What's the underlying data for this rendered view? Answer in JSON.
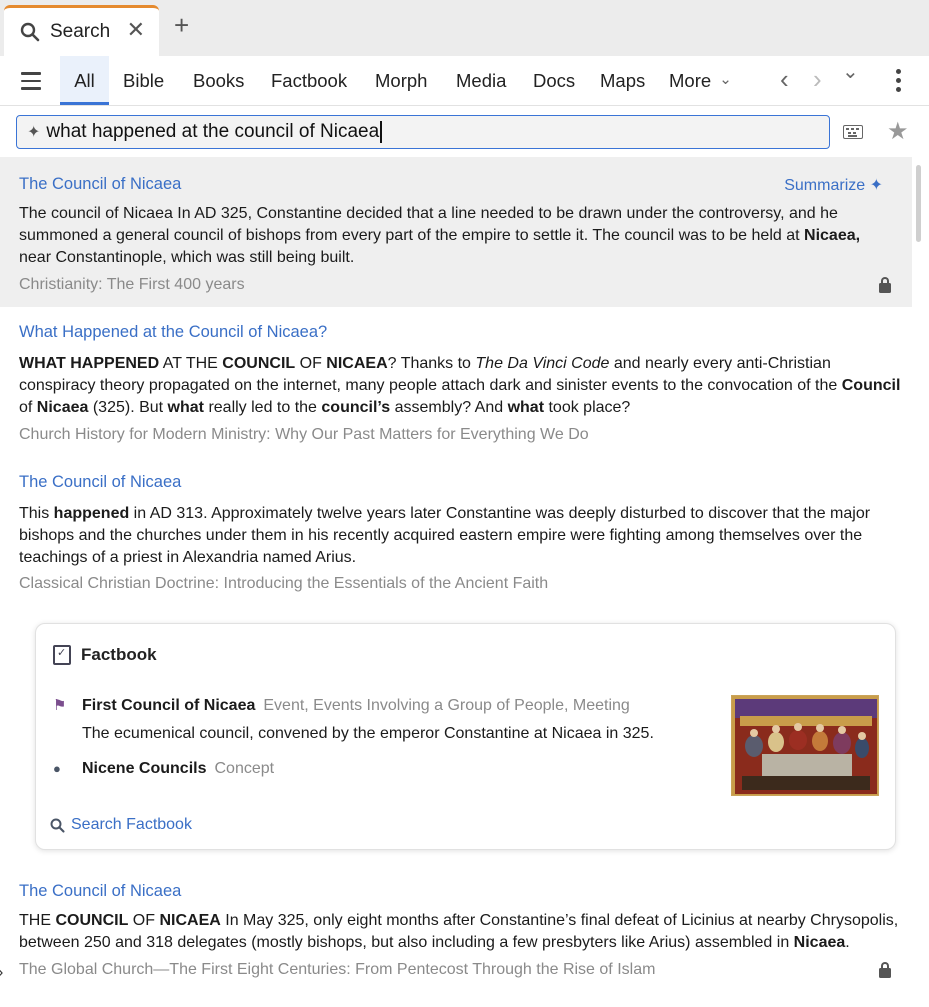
{
  "tab": {
    "title": "Search",
    "close": "✕",
    "new_tab": "+"
  },
  "nav": {
    "tabs": [
      {
        "label": "All",
        "active": true
      },
      {
        "label": "Bible"
      },
      {
        "label": "Books"
      },
      {
        "label": "Factbook"
      },
      {
        "label": "Morph"
      },
      {
        "label": "Media"
      },
      {
        "label": "Docs"
      },
      {
        "label": "Maps"
      },
      {
        "label": "More"
      }
    ],
    "back": "‹",
    "forward": "›",
    "history": "⌄",
    "more_chevron": "⌄"
  },
  "search": {
    "query": "what happened at the council of Nicaea",
    "sparkle": "✦"
  },
  "summarize": {
    "label": "Summarize",
    "icon": "✦"
  },
  "results": [
    {
      "title": "The Council of Nicaea",
      "body": [
        {
          "t": "The council of Nicaea In AD 325, Constantine decided that a line needed to be drawn under the controversy, and he summoned a general council of bishops from every part of the empire to settle it. The council was to be held at "
        },
        {
          "t": "Nicaea,",
          "b": true
        },
        {
          "t": " near Constantinople, which was still being built."
        }
      ],
      "source": "Christianity: The First 400 years",
      "locked": true
    },
    {
      "title": "What Happened at the Council of Nicaea?",
      "body": [
        {
          "t": "WHAT HAPPENED",
          "b": true
        },
        {
          "t": " AT THE "
        },
        {
          "t": "COUNCIL",
          "b": true
        },
        {
          "t": " OF "
        },
        {
          "t": "NICAEA",
          "b": true
        },
        {
          "t": "? Thanks to "
        },
        {
          "t": "The Da Vinci Code",
          "i": true
        },
        {
          "t": " and nearly every anti-Christian conspiracy theory propagated on the internet, many people attach dark and sinister events to the convocation of the "
        },
        {
          "t": "Council",
          "b": true
        },
        {
          "t": " of "
        },
        {
          "t": "Nicaea",
          "b": true
        },
        {
          "t": " (325). But "
        },
        {
          "t": "what",
          "b": true
        },
        {
          "t": " really led to the "
        },
        {
          "t": "council’s",
          "b": true
        },
        {
          "t": " assembly? And "
        },
        {
          "t": "what",
          "b": true
        },
        {
          "t": " took place?"
        }
      ],
      "source": "Church History for Modern Ministry: Why Our Past Matters for Everything We Do"
    },
    {
      "title": "The Council of Nicaea",
      "body": [
        {
          "t": "This "
        },
        {
          "t": "happened",
          "b": true
        },
        {
          "t": " in AD 313. Approximately twelve years later Constantine was deeply disturbed to discover that the major bishops and the churches under them in his recently acquired eastern empire were fighting among themselves over the teachings of a priest in Alexandria named Arius."
        }
      ],
      "source": "Classical Christian Doctrine: Introducing the Essentials of the Ancient Faith"
    },
    {
      "title": "The Council of Nicaea",
      "body": [
        {
          "t": "THE "
        },
        {
          "t": "COUNCIL",
          "b": true
        },
        {
          "t": " OF "
        },
        {
          "t": "NICAEA",
          "b": true
        },
        {
          "t": " In May 325, only eight months after Constantine’s final defeat of Licinius at nearby Chrysopolis, between 250 and 318 delegates (mostly bishops, but also including a few presbyters like Arius) assembled in "
        },
        {
          "t": "Nicaea",
          "b": true
        },
        {
          "t": "."
        }
      ],
      "source": "The Global Church—The First Eight Centuries: From Pentecost Through the Rise of Islam",
      "locked": true
    }
  ],
  "factbook": {
    "title": "Factbook",
    "entries": [
      {
        "name": "First Council of Nicaea",
        "meta": "Event, Events Involving a Group of People, Meeting",
        "icon": "⚑"
      },
      {
        "name": "Nicene Councils",
        "meta": "Concept",
        "icon": "●"
      }
    ],
    "description": "The ecumenical council, convened by the emperor Constantine at Nicaea in 325.",
    "search_label": "Search Factbook"
  },
  "colors": {
    "accent": "#3a74d6",
    "link": "#3a6fc6",
    "tab_top": "#e58a2e"
  }
}
